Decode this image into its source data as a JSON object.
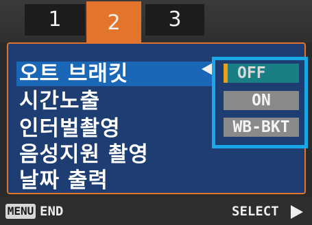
{
  "tabs": [
    {
      "label": "1",
      "active": false
    },
    {
      "label": "2",
      "active": true
    },
    {
      "label": "3",
      "active": false
    }
  ],
  "menu": {
    "items": [
      {
        "label": "오트 브래킷",
        "selected": true
      },
      {
        "label": "시간노출",
        "selected": false
      },
      {
        "label": "인터벌촬영",
        "selected": false
      },
      {
        "label": "음성지원 촬영",
        "selected": false
      },
      {
        "label": "날짜 출력",
        "selected": false
      }
    ]
  },
  "options": {
    "items": [
      {
        "label": "OFF",
        "active": true
      },
      {
        "label": "ON",
        "active": false
      },
      {
        "label": "WB-BKT",
        "active": false
      }
    ]
  },
  "footer": {
    "menu_key": "MENU",
    "end_label": "END",
    "select_label": "SELECT"
  },
  "colors": {
    "accent_tab": "#e2742b",
    "panel_bg": "#1d3d73",
    "selected_row": "#1a66b7",
    "option_frame": "#1aa7e8",
    "active_option": "#1a7f84",
    "cursor": "#e8a018"
  },
  "icons": {
    "pointer": "left-triangle-icon",
    "select": "right-triangle-icon"
  }
}
